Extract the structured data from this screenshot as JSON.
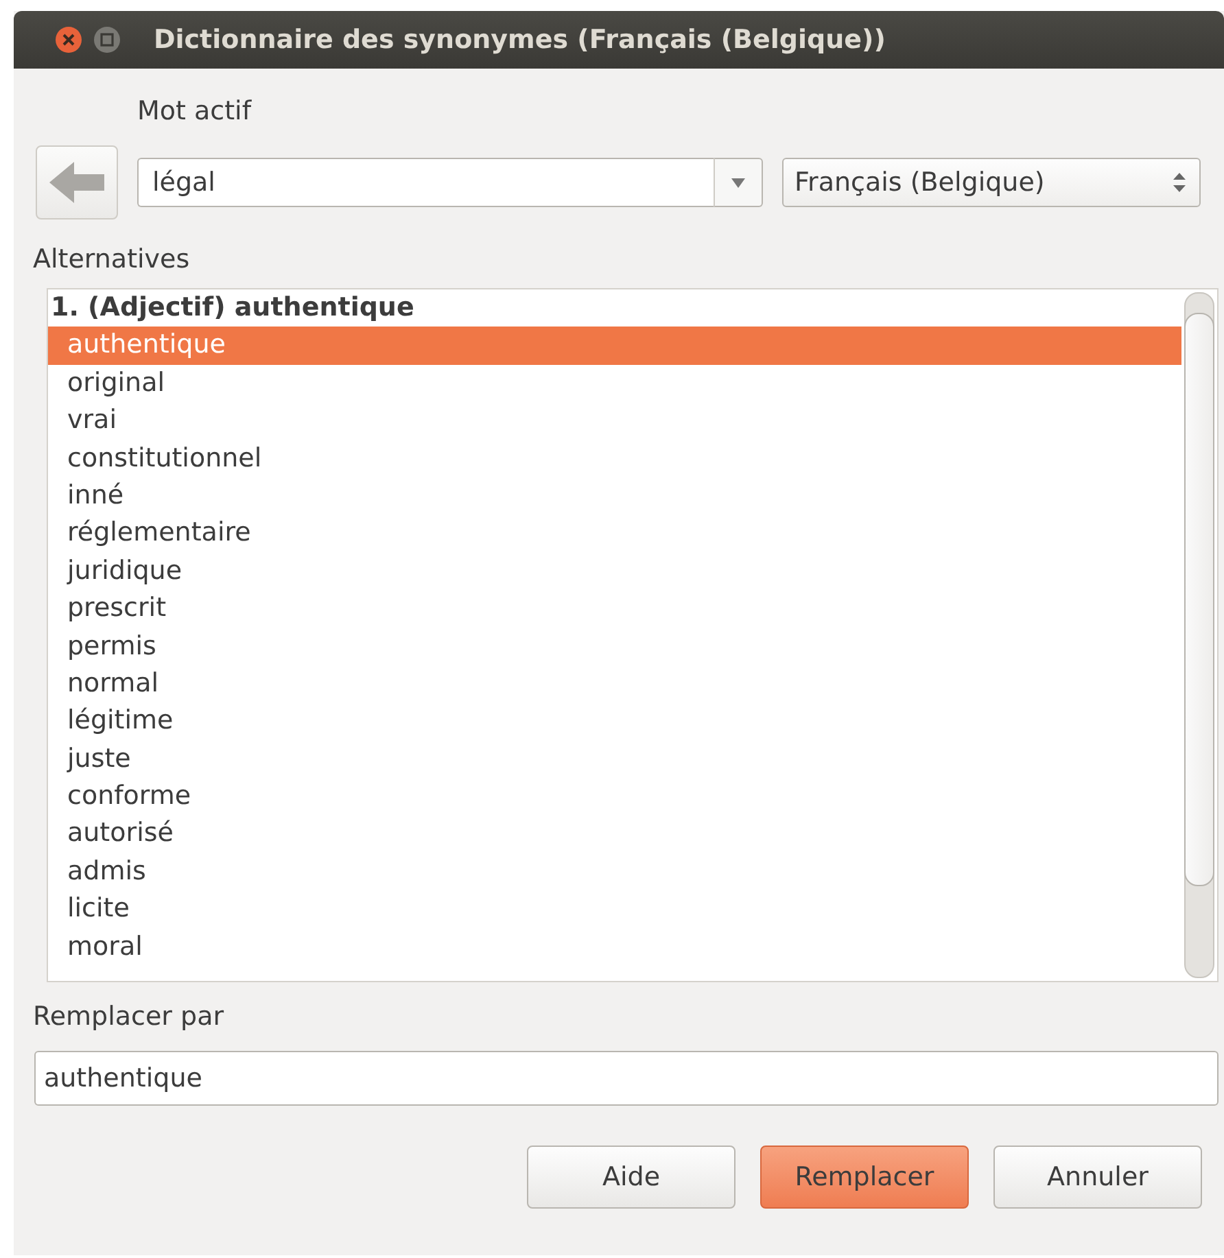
{
  "window": {
    "title": "Dictionnaire des synonymes (Français (Belgique))"
  },
  "active_word": {
    "label": "Mot actif",
    "value": "légal"
  },
  "language": {
    "value": "Français (Belgique)"
  },
  "alternatives": {
    "label": "Alternatives",
    "groups": [
      {
        "heading": "1. (Adjectif) authentique",
        "items": [
          {
            "text": "authentique",
            "selected": true
          },
          {
            "text": "original",
            "selected": false
          },
          {
            "text": "vrai",
            "selected": false
          },
          {
            "text": "constitutionnel",
            "selected": false
          },
          {
            "text": "inné",
            "selected": false
          },
          {
            "text": "réglementaire",
            "selected": false
          },
          {
            "text": "juridique",
            "selected": false
          },
          {
            "text": "prescrit",
            "selected": false
          },
          {
            "text": "permis",
            "selected": false
          },
          {
            "text": "normal",
            "selected": false
          },
          {
            "text": "légitime",
            "selected": false
          },
          {
            "text": "juste",
            "selected": false
          },
          {
            "text": "conforme",
            "selected": false
          },
          {
            "text": "autorisé",
            "selected": false
          },
          {
            "text": "admis",
            "selected": false
          },
          {
            "text": "licite",
            "selected": false
          },
          {
            "text": "moral",
            "selected": false
          }
        ]
      }
    ]
  },
  "replace": {
    "label": "Remplacer par",
    "value": "authentique"
  },
  "buttons": [
    {
      "label": "Aide",
      "kind": "normal"
    },
    {
      "label": "Remplacer",
      "kind": "default"
    },
    {
      "label": "Annuler",
      "kind": "normal"
    }
  ]
}
